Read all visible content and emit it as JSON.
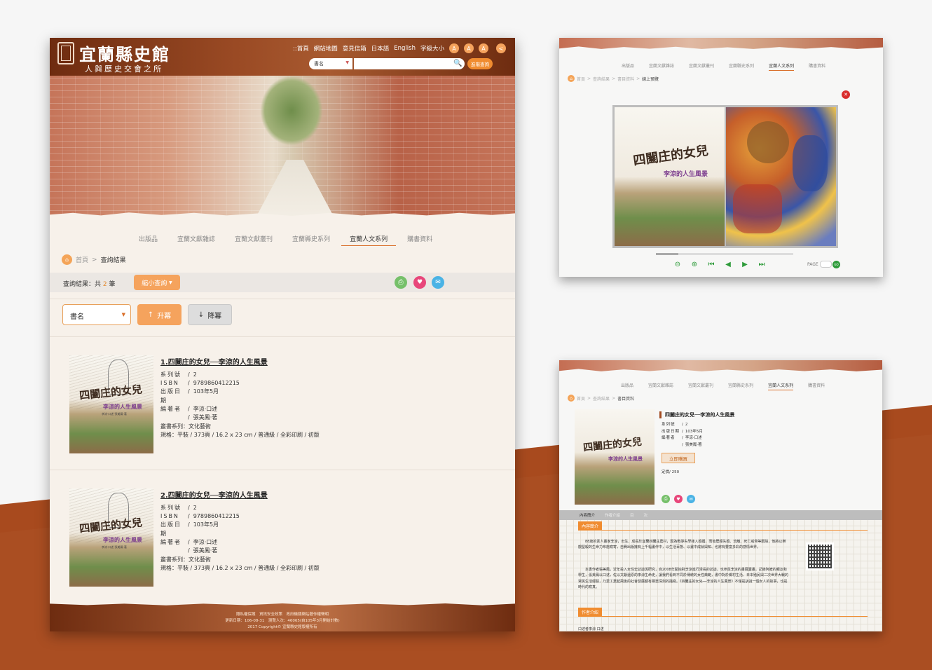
{
  "colors": {
    "brand": "#8a3b18",
    "accent": "#f08c30",
    "rust_bg": "#a84a1e"
  },
  "site": {
    "title": "宜蘭縣史館",
    "subtitle": "人與歷史交會之所",
    "top_nav": [
      "::首頁",
      "網站地圖",
      "意見信箱",
      "日本語",
      "English",
      "字級大小"
    ],
    "font_sizes": [
      "A",
      "A",
      "A"
    ],
    "search_select": "書名",
    "search_placeholder": "",
    "advanced_search": "進階查詢"
  },
  "category_nav": [
    "出版品",
    "宜蘭文獻雜誌",
    "宜蘭文獻叢刊",
    "宜蘭縣史系列",
    "宜蘭人文系列",
    "購書資料"
  ],
  "active_category": "宜蘭人文系列",
  "breadcrumb": {
    "home": "首頁",
    "sep": ">",
    "current": "查詢結果"
  },
  "results": {
    "label_prefix": "查詢結果：共",
    "count": "2",
    "label_suffix": "筆",
    "narrow": "縮小查詢",
    "sort_field": "書名",
    "asc": "升冪",
    "desc": "降冪"
  },
  "book_cover": {
    "title": "四闔庄的女兒",
    "subtitle": "李涼的人生風景",
    "byline": "李涼‧口述 張美鳳‧著"
  },
  "entries": [
    {
      "title": "1.四闔庄的女兒──李涼的人生風景",
      "series_no_k": "系列號",
      "series_no": "2",
      "isbn_k": "ISBN",
      "isbn": "9789860412215",
      "date_k": "出版日期",
      "date": "103年5月",
      "author_k": "編著者",
      "author1": "李涼‧口述",
      "author2": "張美鳳‧著",
      "collection": "叢書系列：文化藝術",
      "spec": "規格：平裝 / 373頁 / 16.2 x 23 cm / 普通級 / 全彩印刷 / 初版"
    },
    {
      "title": "2.四闔庄的女兒──李涼的人生風景",
      "series_no_k": "系列號",
      "series_no": "2",
      "isbn_k": "ISBN",
      "isbn": "9789860412215",
      "date_k": "出版日期",
      "date": "103年5月",
      "author_k": "編著者",
      "author1": "李涼‧口述",
      "author2": "張美鳳‧著",
      "collection": "叢書系列：文化藝術",
      "spec": "規格：平裝 / 373頁 / 16.2 x 23 cm / 普通級 / 全彩印刷 / 初版"
    }
  ],
  "footer": {
    "line1": "隱私權保護　資訊安全政策　政府機關網站著作權聲明",
    "line2": "更新日期：106-08-31　瀏覽人次：46065(自105年3月開始計數)",
    "line3": "2017 Copyright© 宜蘭縣史館版權所有"
  },
  "viewer": {
    "breadcrumb": [
      "首頁",
      ">",
      "查詢結果",
      ">",
      "書目資料",
      ">",
      "線上預覽"
    ],
    "page_label": "PAGE",
    "go": "GO",
    "controls": [
      "zoom-out",
      "zoom-in",
      "first",
      "prev",
      "next",
      "last"
    ]
  },
  "detail": {
    "breadcrumb": [
      "首頁",
      ">",
      "查詢結果",
      ">",
      "書目資料"
    ],
    "title": "四闔庄的女兒──李涼的人生風景",
    "series_no_k": "系列號",
    "series_no": "2",
    "date_k": "出版日期",
    "date": "103年5月",
    "author_k": "編著者",
    "author1": "李涼‧口述",
    "author2": "張美鳳‧著",
    "buy": "立即購買",
    "price": "定價/ 250",
    "tabs": [
      "內容簡介",
      "作者介紹",
      "目",
      "次"
    ],
    "intro_label": "內容簡介",
    "intro_p1": "88歲的素人畫家李涼，出生、成長於宜蘭四闔庄農村，因為戰爭失學嫁入婚姻，而後歷經失婚、流離、死亡威脅等困境，他將以樂觀堅毅的生命力布施寫寄，自費出版擁有上千幅畫作中，以生活百態、以畫中成就與知、也將有豐富多彩的感情世界。",
    "intro_p2": "本書作者張美鳳，近年投入女性史訪談與研究，自2008年開始對李涼進行漫長的訪談，也參與李涼的畫展籌畫，記錄阿嬤的親友和學生，張美鳳以口述，佐以文獻還原的李涼生命史，讓我們看到不同於傳統的女性典範，書中對於鄉村生活、日本殖民與二次世界大戰的常民生活經驗，乃至工業起飛後的社會發展都有相當深刻的描寫。《四闔庄的女兒──李涼的人生風景》不僅是訴說一個女人的故事，也是時代的寫真。",
    "author_label": "作者介紹",
    "author_text": "口述者李涼 口述"
  }
}
